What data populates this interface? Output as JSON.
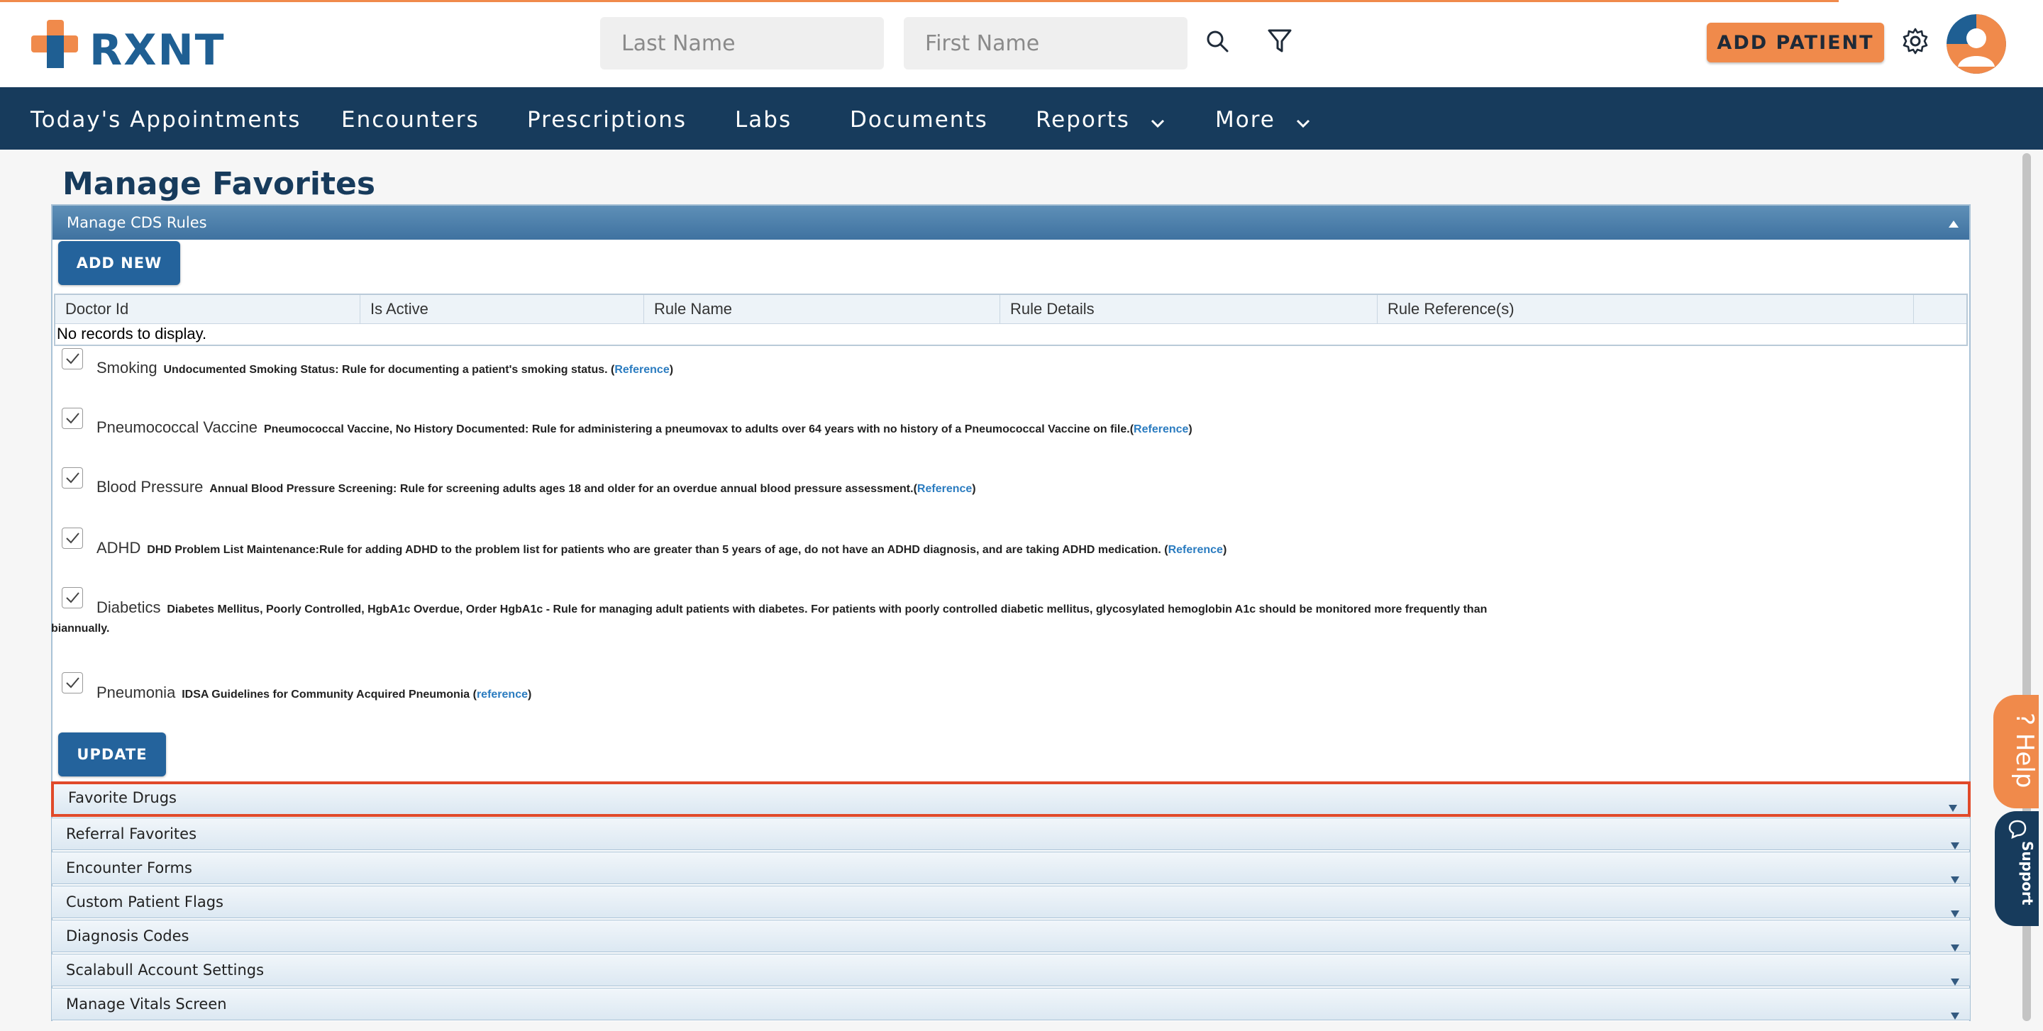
{
  "header": {
    "logo_text": "RXNT",
    "last_name_placeholder": "Last Name",
    "first_name_placeholder": "First Name",
    "add_patient_label": "ADD PATIENT",
    "brand_orange": "#f08a4b",
    "brand_navy": "#173b5c"
  },
  "nav": {
    "items": [
      {
        "label": "Today's Appointments"
      },
      {
        "label": "Encounters"
      },
      {
        "label": "Prescriptions"
      },
      {
        "label": "Labs"
      },
      {
        "label": "Documents"
      },
      {
        "label": "Reports"
      },
      {
        "label": "More"
      }
    ]
  },
  "page": {
    "title": "Manage Favorites"
  },
  "cds_panel": {
    "title": "Manage CDS Rules",
    "add_new_label": "ADD NEW",
    "update_label": "UPDATE",
    "grid": {
      "columns": [
        "Doctor Id",
        "Is Active",
        "Rule Name",
        "Rule Details",
        "Rule Reference(s)"
      ],
      "empty_text": "No records to display."
    },
    "rules": [
      {
        "name": "Smoking",
        "description": "Undocumented Smoking Status: Rule for documenting a patient's smoking status. (",
        "ref_label": "Reference",
        "suffix": ")",
        "checked": true
      },
      {
        "name": "Pneumococcal Vaccine",
        "description": "Pneumococcal Vaccine, No History Documented: Rule for administering a pneumovax to adults over 64 years with no history of a Pneumococcal Vaccine on file.(",
        "ref_label": "Reference",
        "suffix": ")",
        "checked": true
      },
      {
        "name": "Blood Pressure",
        "description": "Annual Blood Pressure Screening: Rule for screening adults ages 18 and older for an overdue annual blood pressure assessment.(",
        "ref_label": "Reference",
        "suffix": ")",
        "checked": true
      },
      {
        "name": "ADHD",
        "description": "DHD Problem List Maintenance:Rule for adding ADHD to the problem list for patients who are greater than 5 years of age, do not have an ADHD diagnosis, and are taking ADHD medication. (",
        "ref_label": "Reference",
        "suffix": ")",
        "checked": true
      },
      {
        "name": "Diabetics",
        "description": "Diabetes Mellitus, Poorly Controlled, HgbA1c Overdue, Order HgbA1c - Rule for managing adult patients with diabetes. For patients with poorly controlled diabetic mellitus, glycosylated hemoglobin A1c should be monitored more frequently than",
        "description_cont": "biannually.",
        "checked": true
      },
      {
        "name": "Pneumonia",
        "description": "IDSA Guidelines for Community Acquired Pneumonia (",
        "ref_label": "reference",
        "suffix": ")",
        "checked": true
      }
    ]
  },
  "sections": [
    {
      "label": "Favorite Drugs",
      "highlighted": true
    },
    {
      "label": "Referral Favorites"
    },
    {
      "label": "Encounter Forms"
    },
    {
      "label": "Custom Patient Flags"
    },
    {
      "label": "Diagnosis Codes"
    },
    {
      "label": "Scalabull Account Settings"
    },
    {
      "label": "Manage Vitals Screen"
    }
  ],
  "side_tabs": {
    "help_label": "? Help",
    "support_label": "Support"
  }
}
